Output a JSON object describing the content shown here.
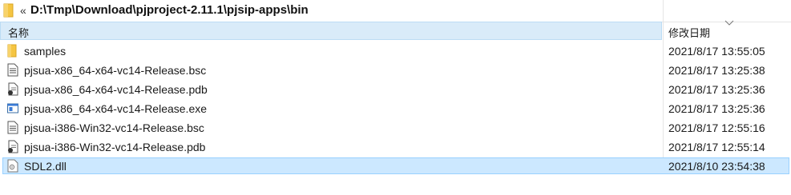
{
  "address_bar": {
    "overflow_chevron": "«",
    "path": "D:\\Tmp\\Download\\pjproject-2.11.1\\pjsip-apps\\bin"
  },
  "columns": {
    "name": "名称",
    "date_modified": "修改日期"
  },
  "files": [
    {
      "name": "samples",
      "date": "2021/8/17 13:55:05",
      "icon": "folder-icon",
      "selected": false
    },
    {
      "name": "pjsua-x86_64-x64-vc14-Release.bsc",
      "date": "2021/8/17 13:25:38",
      "icon": "document-icon",
      "selected": false
    },
    {
      "name": "pjsua-x86_64-x64-vc14-Release.pdb",
      "date": "2021/8/17 13:25:36",
      "icon": "pdb-file-icon",
      "selected": false
    },
    {
      "name": "pjsua-x86_64-x64-vc14-Release.exe",
      "date": "2021/8/17 13:25:36",
      "icon": "exe-file-icon",
      "selected": false
    },
    {
      "name": "pjsua-i386-Win32-vc14-Release.bsc",
      "date": "2021/8/17 12:55:16",
      "icon": "document-icon",
      "selected": false
    },
    {
      "name": "pjsua-i386-Win32-vc14-Release.pdb",
      "date": "2021/8/17 12:55:14",
      "icon": "pdb-file-icon",
      "selected": false
    },
    {
      "name": "SDL2.dll",
      "date": "2021/8/10 23:54:38",
      "icon": "dll-file-icon",
      "selected": true
    }
  ],
  "colors": {
    "selection_fill": "#cce8ff",
    "selection_border": "#99d1ff",
    "header_highlight": "#d9ebf9",
    "folder_yellow": "#f5c542"
  }
}
